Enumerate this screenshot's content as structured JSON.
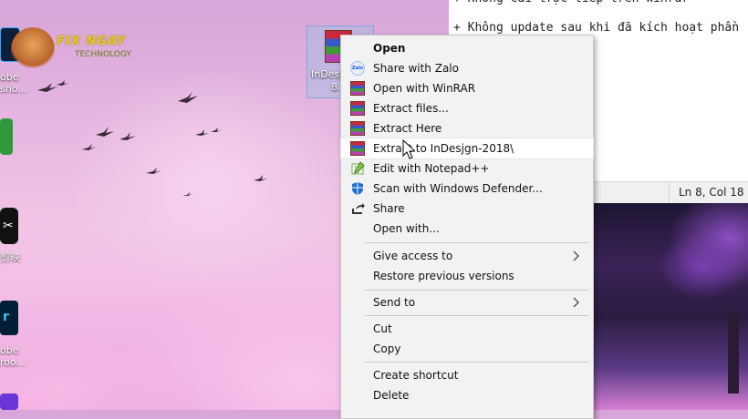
{
  "desktop": {
    "logo_brand": "FIX NGAY",
    "logo_sub": "TECHNOLOGY",
    "icon_labels": [
      {
        "text": "obe\nsho..."
      },
      {
        "text": "剪映"
      },
      {
        "text": "obe\nroo..."
      }
    ],
    "selected_file_label": "InDesjgn-2018",
    "selected_file_label_short": "InDesj",
    "selected_file_label_line2": "8."
  },
  "notepad": {
    "lines": [
      "+ Không cài trực tiếp trên Winrar",
      "+ Không update sau khi đã kích hoạt phần"
    ],
    "status_position": "Ln 8, Col 18"
  },
  "context_menu": {
    "items": [
      {
        "label": "Open",
        "bold": true,
        "icon": "none"
      },
      {
        "label": "Share with Zalo",
        "icon": "zalo-icon"
      },
      {
        "label": "Open with WinRAR",
        "icon": "winrar-icon"
      },
      {
        "label": "Extract files...",
        "icon": "winrar-icon"
      },
      {
        "label": "Extract Here",
        "icon": "winrar-icon"
      },
      {
        "label": "Extract to InDesjgn-2018\\",
        "icon": "winrar-icon",
        "highlighted": true
      },
      {
        "label": "Edit with Notepad++",
        "icon": "notepadpp-icon"
      },
      {
        "label": "Scan with Windows Defender...",
        "icon": "defender-icon"
      },
      {
        "label": "Share",
        "icon": "share-icon"
      },
      {
        "label": "Open with...",
        "icon": "none"
      },
      {
        "label": "Give access to",
        "icon": "none",
        "submenu": true
      },
      {
        "label": "Restore previous versions",
        "icon": "none"
      },
      {
        "label": "Send to",
        "icon": "none",
        "submenu": true
      },
      {
        "label": "Cut",
        "icon": "none"
      },
      {
        "label": "Copy",
        "icon": "none"
      },
      {
        "label": "Create shortcut",
        "icon": "none"
      },
      {
        "label": "Delete",
        "icon": "none"
      }
    ]
  },
  "colors": {
    "menu_bg": "#f2f2f2",
    "highlight_bg": "#ffffff",
    "wallpaper_pink": "#f2c4e6"
  }
}
